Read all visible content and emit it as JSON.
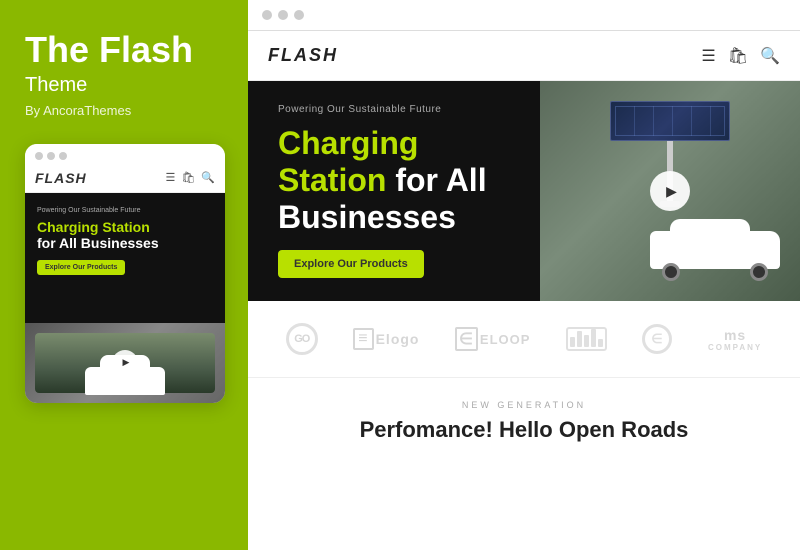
{
  "leftPanel": {
    "title": "The Flash",
    "subtitle": "Theme",
    "author": "By AncoraThemes"
  },
  "mobileMockup": {
    "logo": "FLASH",
    "heroSmallText": "Powering Our Sustainable Future",
    "heroTitle1": "Charging Station",
    "heroTitle2": "for All Businesses",
    "ctaButton": "Explore Our Products"
  },
  "browser": {
    "dots": [
      "dot1",
      "dot2",
      "dot3"
    ]
  },
  "siteNav": {
    "logo": "FLASH"
  },
  "hero": {
    "smallText": "Powering Our Sustainable Future",
    "titleGreen": "Charging",
    "titleGreen2": "Station",
    "titleWhite": " for All",
    "titleWhite2": "Businesses",
    "cta": "Explore Our Products"
  },
  "logos": [
    {
      "id": "go",
      "type": "go"
    },
    {
      "id": "elogo",
      "type": "elogo",
      "text": "Elogo"
    },
    {
      "id": "eloop",
      "type": "eloop",
      "text": "ELOOP"
    },
    {
      "id": "bars",
      "type": "bars"
    },
    {
      "id": "circle-e",
      "type": "circle-e"
    },
    {
      "id": "company",
      "type": "company",
      "line1": "ms",
      "line2": "COMPANY"
    }
  ],
  "newGen": {
    "label": "NEW GENERATION",
    "title": "Perfomance! Hello Open Roads"
  }
}
